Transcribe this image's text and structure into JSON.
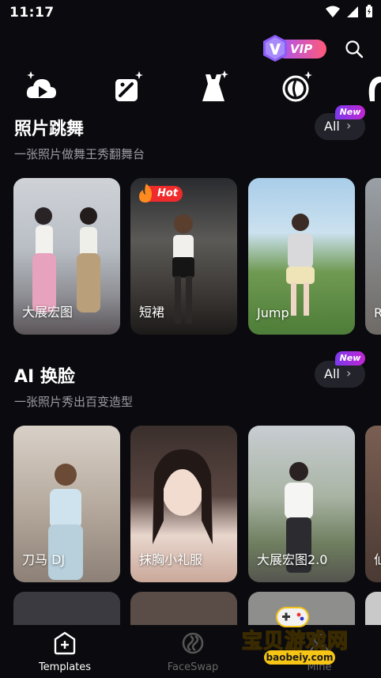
{
  "status": {
    "time": "11:17"
  },
  "topbar": {
    "vip_label": "VIP"
  },
  "sections": [
    {
      "title": "照片跳舞",
      "subtitle": "一张照片做舞王秀翻舞台",
      "all_label": "All",
      "badge": "New",
      "cards": [
        {
          "caption": "大展宏图"
        },
        {
          "caption": "短裙",
          "badge": "Hot"
        },
        {
          "caption": "Jump"
        },
        {
          "caption": "R"
        }
      ]
    },
    {
      "title": "AI 换脸",
      "subtitle": "一张照片秀出百变造型",
      "all_label": "All",
      "badge": "New",
      "cards": [
        {
          "caption": "刀马 DJ"
        },
        {
          "caption": "抹胸小礼服"
        },
        {
          "caption": "大展宏图2.0"
        },
        {
          "caption": "仙"
        }
      ]
    }
  ],
  "nav": {
    "items": [
      {
        "label": "Templates"
      },
      {
        "label": "FaceSwap"
      },
      {
        "label": "Mine"
      }
    ]
  },
  "watermark": {
    "line1": "宝贝游戏网",
    "line2": "baobeiy.com"
  },
  "colors": {
    "accent": "#a855f7",
    "hot": "#ef2b2b",
    "background": "#0b0b0f",
    "card_bg": "#23232b"
  }
}
